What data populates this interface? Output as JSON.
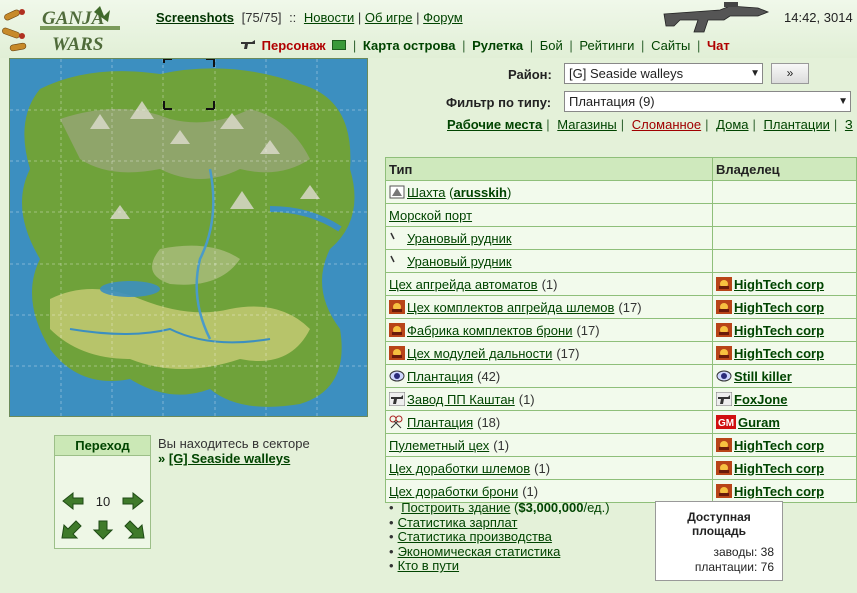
{
  "header": {
    "screenshots_label": "Screenshots",
    "screenshots_count": "[75/75]",
    "sep": "::",
    "links": [
      "Новости",
      "Об игре",
      "Форум"
    ],
    "clock": "14:42, 3014"
  },
  "nav": {
    "items": [
      {
        "label": "Персонаж",
        "style": "red"
      },
      {
        "label": "Карта острова",
        "style": "bold"
      },
      {
        "label": "Рулетка",
        "style": "bold"
      },
      {
        "label": "Бой",
        "style": "normal"
      },
      {
        "label": "Рейтинги",
        "style": "normal"
      },
      {
        "label": "Сайты",
        "style": "normal"
      },
      {
        "label": "Чат",
        "style": "red"
      }
    ]
  },
  "map": {
    "grid_cols": 7,
    "grid_rows": 7,
    "selected_col": 3,
    "selected_row": 0
  },
  "transit": {
    "title": "Переход",
    "sector": "10"
  },
  "location": {
    "text": "Вы находитесь в секторе",
    "prefix": "»",
    "sector": "[G] Seaside walleys"
  },
  "district": {
    "label": "Район:",
    "value": "[G] Seaside walleys",
    "go": "»"
  },
  "filter": {
    "label": "Фильтр по типу:",
    "value": "Плантация (9)"
  },
  "categories": [
    {
      "label": "Рабочие места",
      "style": "act"
    },
    {
      "label": "Магазины",
      "style": "n"
    },
    {
      "label": "Сломанное",
      "style": "broken"
    },
    {
      "label": "Дома",
      "style": "n"
    },
    {
      "label": "Плантации",
      "style": "n"
    },
    {
      "label": "З",
      "style": "n"
    }
  ],
  "table": {
    "headers": [
      "Тип",
      "Владелец"
    ],
    "rows": [
      {
        "icon": "mine-icon",
        "name": "Шахта",
        "count": "",
        "owner_inline": "arusskih",
        "owner": "",
        "owner_icon": ""
      },
      {
        "icon": "",
        "name": "Морской порт",
        "count": "",
        "owner_inline": "",
        "owner": "",
        "owner_icon": ""
      },
      {
        "icon": "tick-icon",
        "name": "Урановый рудник",
        "count": "",
        "owner_inline": "",
        "owner": "",
        "owner_icon": ""
      },
      {
        "icon": "tick-icon",
        "name": "Урановый рудник",
        "count": "",
        "owner_inline": "",
        "owner": "",
        "owner_icon": ""
      },
      {
        "icon": "",
        "name": "Цех апгрейда автоматов",
        "count": "(1)",
        "owner_inline": "",
        "owner": "HighTech corp",
        "owner_icon": "corp-icon"
      },
      {
        "icon": "corp-icon",
        "name": "Цех комплектов апгрейда шлемов",
        "count": "(17)",
        "owner_inline": "",
        "owner": "HighTech corp",
        "owner_icon": "corp-icon"
      },
      {
        "icon": "corp-icon",
        "name": "Фабрика комплектов брони",
        "count": "(17)",
        "owner_inline": "",
        "owner": "HighTech corp",
        "owner_icon": "corp-icon"
      },
      {
        "icon": "corp-icon",
        "name": "Цех модулей дальности",
        "count": "(17)",
        "owner_inline": "",
        "owner": "HighTech corp",
        "owner_icon": "corp-icon"
      },
      {
        "icon": "eye-icon",
        "name": "Плантация",
        "count": "(42)",
        "owner_inline": "",
        "owner": "Still killer",
        "owner_icon": "eye-icon"
      },
      {
        "icon": "gun-icon",
        "name": "Завод ПП Каштан",
        "count": "(1)",
        "owner_inline": "",
        "owner": "FoxJone",
        "owner_icon": "gun-icon"
      },
      {
        "icon": "scissors-icon",
        "name": "Плантация",
        "count": "(18)",
        "owner_inline": "",
        "owner": "Guram",
        "owner_icon": "gm-icon"
      },
      {
        "icon": "",
        "name": "Пулеметный цех",
        "count": "(1)",
        "owner_inline": "",
        "owner": "HighTech corp",
        "owner_icon": "corp-icon"
      },
      {
        "icon": "",
        "name": "Цех доработки шлемов",
        "count": "(1)",
        "owner_inline": "",
        "owner": "HighTech corp",
        "owner_icon": "corp-icon"
      },
      {
        "icon": "",
        "name": "Цех доработки брони",
        "count": "(1)",
        "owner_inline": "",
        "owner": "HighTech corp",
        "owner_icon": "corp-icon"
      }
    ]
  },
  "actions": [
    {
      "label": "Построить здание",
      "extra": " (",
      "price": "$3,000,000",
      "tail": "/ед.)"
    },
    {
      "label": "Статистика зарплат",
      "extra": "",
      "price": "",
      "tail": ""
    },
    {
      "label": "Статистика производства",
      "extra": "",
      "price": "",
      "tail": ""
    },
    {
      "label": "Экономическая статистика",
      "extra": "",
      "price": "",
      "tail": ""
    },
    {
      "label": "Кто в пути",
      "extra": "",
      "price": "",
      "tail": ""
    }
  ],
  "area": {
    "title_1": "Доступная",
    "title_2": "площадь",
    "factories_label": "заводы:",
    "factories": "38",
    "plantations_label": "плантации:",
    "plantations": "76"
  },
  "colors": {
    "accent_red": "#b00000",
    "link_green": "#004400",
    "table_header": "#cfe9bd",
    "bg": "#e4f1d9"
  }
}
